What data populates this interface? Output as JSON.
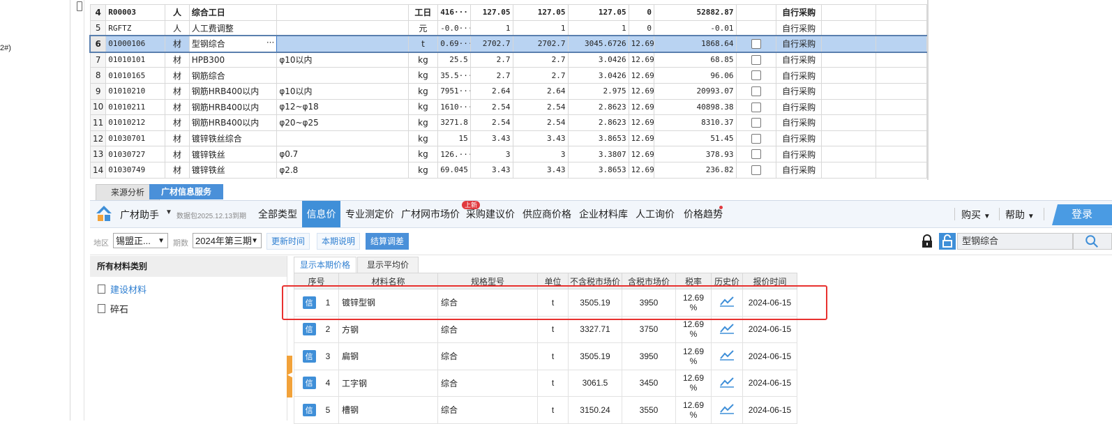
{
  "left_strip": {
    "fragment": "2#)"
  },
  "top_grid": {
    "rows": [
      {
        "n": "4",
        "code": "R00003",
        "type": "人",
        "name": "综合工日",
        "spec": "",
        "unit": "工日",
        "qty": "416···",
        "p1": "127.05",
        "p2": "127.05",
        "p3": "127.05",
        "rate": "0",
        "total": "52882.87",
        "src": "自行采购",
        "bold": true,
        "cb": false
      },
      {
        "n": "5",
        "code": "RGFTZ",
        "type": "人",
        "name": "人工费调整",
        "spec": "",
        "unit": "元",
        "qty": "-0.0···",
        "p1": "1",
        "p2": "1",
        "p3": "1",
        "rate": "0",
        "total": "-0.01",
        "src": "自行采购",
        "bold": false,
        "cb": false
      },
      {
        "n": "6",
        "code": "01000106",
        "type": "材",
        "name": "型钢综合",
        "spec": "",
        "unit": "t",
        "qty": "0.69···",
        "p1": "2702.7",
        "p2": "2702.7",
        "p3": "3045.6726",
        "rate": "12.69",
        "total": "1868.64",
        "src": "自行采购",
        "bold": false,
        "cb": true,
        "selected": true,
        "ellipsis": "···"
      },
      {
        "n": "7",
        "code": "01010101",
        "type": "材",
        "name": "HPB300",
        "spec": "φ10以内",
        "unit": "kg",
        "qty": "25.5",
        "p1": "2.7",
        "p2": "2.7",
        "p3": "3.0426",
        "rate": "12.69",
        "total": "68.85",
        "src": "自行采购",
        "bold": false,
        "cb": true
      },
      {
        "n": "8",
        "code": "01010165",
        "type": "材",
        "name": "钢筋综合",
        "spec": "",
        "unit": "kg",
        "qty": "35.5···",
        "p1": "2.7",
        "p2": "2.7",
        "p3": "3.0426",
        "rate": "12.69",
        "total": "96.06",
        "src": "自行采购",
        "bold": false,
        "cb": true
      },
      {
        "n": "9",
        "code": "01010210",
        "type": "材",
        "name": "钢筋HRB400以内",
        "spec": "φ10以内",
        "unit": "kg",
        "qty": "7951···",
        "p1": "2.64",
        "p2": "2.64",
        "p3": "2.975",
        "rate": "12.69",
        "total": "20993.07",
        "src": "自行采购",
        "bold": false,
        "cb": true
      },
      {
        "n": "10",
        "code": "01010211",
        "type": "材",
        "name": "钢筋HRB400以内",
        "spec": "φ12~φ18",
        "unit": "kg",
        "qty": "1610···",
        "p1": "2.54",
        "p2": "2.54",
        "p3": "2.8623",
        "rate": "12.69",
        "total": "40898.38",
        "src": "自行采购",
        "bold": false,
        "cb": true
      },
      {
        "n": "11",
        "code": "01010212",
        "type": "材",
        "name": "钢筋HRB400以内",
        "spec": "φ20~φ25",
        "unit": "kg",
        "qty": "3271.8",
        "p1": "2.54",
        "p2": "2.54",
        "p3": "2.8623",
        "rate": "12.69",
        "total": "8310.37",
        "src": "自行采购",
        "bold": false,
        "cb": true
      },
      {
        "n": "12",
        "code": "01030701",
        "type": "材",
        "name": "镀锌铁丝综合",
        "spec": "",
        "unit": "kg",
        "qty": "15",
        "p1": "3.43",
        "p2": "3.43",
        "p3": "3.8653",
        "rate": "12.69",
        "total": "51.45",
        "src": "自行采购",
        "bold": false,
        "cb": true
      },
      {
        "n": "13",
        "code": "01030727",
        "type": "材",
        "name": "镀锌铁丝",
        "spec": "φ0.7",
        "unit": "kg",
        "qty": "126.···",
        "p1": "3",
        "p2": "3",
        "p3": "3.3807",
        "rate": "12.69",
        "total": "378.93",
        "src": "自行采购",
        "bold": false,
        "cb": true
      },
      {
        "n": "14",
        "code": "01030749",
        "type": "材",
        "name": "镀锌铁丝",
        "spec": "φ2.8",
        "unit": "kg",
        "qty": "69.045",
        "p1": "3.43",
        "p2": "3.43",
        "p3": "3.8653",
        "rate": "12.69",
        "total": "236.82",
        "src": "自行采购",
        "bold": false,
        "cb": true
      }
    ]
  },
  "bottom_tabs": {
    "source": "来源分析",
    "info": "广材信息服务"
  },
  "nav": {
    "brand": "广材助手",
    "brand_note": "数据包2025.12.13到期",
    "items": [
      "全部类型",
      "信息价",
      "专业测定价",
      "广材网市场价",
      "采购建议价",
      "供应商价格",
      "企业材料库",
      "人工询价",
      "价格趋势"
    ],
    "badge_new": "上新",
    "buy": "购买",
    "help": "帮助",
    "login": "登录",
    "accent": "#3f8fd8"
  },
  "filters": {
    "region_label": "地区",
    "region_value": "锡盟正...",
    "period_label": "期数",
    "period_value": "2024年第三期",
    "btn_update": "更新时间",
    "btn_notes": "本期说明",
    "btn_settle": "结算调差",
    "search_value": "型钢综合"
  },
  "categories": {
    "header": "所有材料类别",
    "items": [
      "建设材料",
      "碎石"
    ]
  },
  "results": {
    "tab_current": "显示本期价格",
    "tab_avg": "显示平均价",
    "headers": [
      "序号",
      "材料名称",
      "规格型号",
      "单位",
      "不含税市场价",
      "含税市场价",
      "税率",
      "历史价",
      "报价时间"
    ],
    "tag": "信",
    "rows": [
      {
        "n": "1",
        "name": "镀锌型钢",
        "spec": "综合",
        "unit": "t",
        "ex_tax": "3505.19",
        "in_tax": "3950",
        "rate": "12.69",
        "pct": "%",
        "date": "2024-06-15"
      },
      {
        "n": "2",
        "name": "方钢",
        "spec": "综合",
        "unit": "t",
        "ex_tax": "3327.71",
        "in_tax": "3750",
        "rate": "12.69",
        "pct": "%",
        "date": "2024-06-15"
      },
      {
        "n": "3",
        "name": "扁钢",
        "spec": "综合",
        "unit": "t",
        "ex_tax": "3505.19",
        "in_tax": "3950",
        "rate": "12.69",
        "pct": "%",
        "date": "2024-06-15"
      },
      {
        "n": "4",
        "name": "工字钢",
        "spec": "综合",
        "unit": "t",
        "ex_tax": "3061.5",
        "in_tax": "3450",
        "rate": "12.69",
        "pct": "%",
        "date": "2024-06-15"
      },
      {
        "n": "5",
        "name": "槽钢",
        "spec": "综合",
        "unit": "t",
        "ex_tax": "3150.24",
        "in_tax": "3550",
        "rate": "12.69",
        "pct": "%",
        "date": "2024-06-15"
      }
    ]
  }
}
